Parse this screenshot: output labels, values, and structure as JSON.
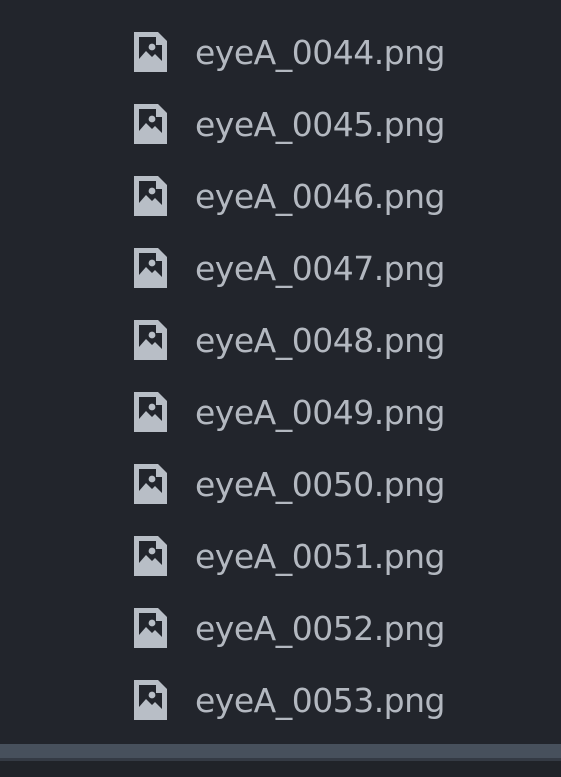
{
  "explorer": {
    "files": [
      {
        "name": "eyeA_0044.png",
        "icon": "image-file-icon"
      },
      {
        "name": "eyeA_0045.png",
        "icon": "image-file-icon"
      },
      {
        "name": "eyeA_0046.png",
        "icon": "image-file-icon"
      },
      {
        "name": "eyeA_0047.png",
        "icon": "image-file-icon"
      },
      {
        "name": "eyeA_0048.png",
        "icon": "image-file-icon"
      },
      {
        "name": "eyeA_0049.png",
        "icon": "image-file-icon"
      },
      {
        "name": "eyeA_0050.png",
        "icon": "image-file-icon"
      },
      {
        "name": "eyeA_0051.png",
        "icon": "image-file-icon"
      },
      {
        "name": "eyeA_0052.png",
        "icon": "image-file-icon"
      },
      {
        "name": "eyeA_0053.png",
        "icon": "image-file-icon"
      }
    ]
  },
  "colors": {
    "background": "#22252c",
    "text": "#b3b8c0",
    "icon": "#b8bec6",
    "scrollbar": "#47505c"
  }
}
